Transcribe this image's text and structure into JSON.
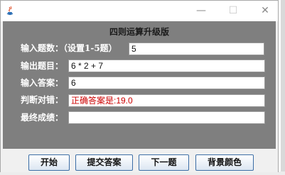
{
  "window": {
    "title": "",
    "controls": {
      "minimize": "—",
      "maximize": "☐",
      "close": "✕"
    }
  },
  "panel": {
    "heading": "四则运算升级版",
    "rows": [
      {
        "label": "输入题数：（设置1-5题）",
        "value": "5"
      },
      {
        "label": "输出题目：",
        "value": "6 * 2 + 7"
      },
      {
        "label": "输入答案：",
        "value": "6"
      },
      {
        "label": "判断对错：",
        "value": "正确答案是:19.0"
      },
      {
        "label": "最终成绩：",
        "value": ""
      }
    ]
  },
  "buttons": {
    "start": "开始",
    "submit": "提交答案",
    "next": "下一题",
    "bg_color": "背景颜色"
  },
  "colors": {
    "panel_bg": "#7f7f7f",
    "result_text": "#cc0000",
    "button_border": "#3c6ea6"
  },
  "icons": [
    "java-app-icon",
    "minimize-icon",
    "maximize-icon",
    "close-icon"
  ]
}
